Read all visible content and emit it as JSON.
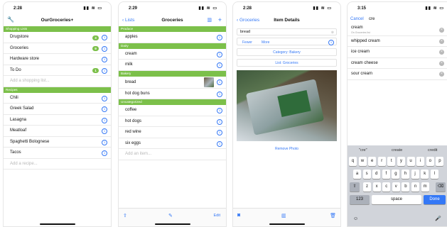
{
  "screen1": {
    "time": "2:28",
    "title": "OurGroceries+",
    "shopping_section": "Shopping Lists",
    "lists": [
      {
        "name": "Drugstore",
        "badge": "3"
      },
      {
        "name": "Groceries",
        "badge": "9"
      },
      {
        "name": "Hardware store",
        "badge": ""
      },
      {
        "name": "To Do",
        "badge": "1"
      }
    ],
    "add_list_placeholder": "Add a shopping list...",
    "recipes_section": "Recipes",
    "recipes": [
      "Chili",
      "Greek Salad",
      "Lasagna",
      "Meatloaf",
      "Spaghetti Bolognese",
      "Tacos"
    ],
    "add_recipe_placeholder": "Add a recipe..."
  },
  "screen2": {
    "time": "2:29",
    "back": "Lists",
    "title": "Groceries",
    "sections": [
      {
        "name": "Produce",
        "items": [
          "apples"
        ]
      },
      {
        "name": "Dairy",
        "items": [
          "cream",
          "milk"
        ]
      },
      {
        "name": "Bakery",
        "items": [
          "bread",
          "hot dog buns"
        ]
      },
      {
        "name": "Uncategorized",
        "items": [
          "coffee",
          "hot dogs",
          "red wine",
          "six eggs"
        ]
      }
    ],
    "add_item_placeholder": "Add an item...",
    "edit": "Edit"
  },
  "screen3": {
    "time": "2:28",
    "back": "Groceries",
    "title": "Item Details",
    "item_name": "bread",
    "fewer": "Fewer",
    "more": "More",
    "category_button": "Category: Bakery",
    "list_button": "List: Groceries",
    "remove_photo": "Remove Photo"
  },
  "screen4": {
    "time": "3:15",
    "cancel": "Cancel",
    "query": "cre",
    "results": [
      {
        "text": "cream",
        "sub": "On Groceries list"
      },
      {
        "text": "whipped cream",
        "sub": ""
      },
      {
        "text": "ice cream",
        "sub": ""
      },
      {
        "text": "cream cheese",
        "sub": ""
      },
      {
        "text": "sour cream",
        "sub": ""
      }
    ],
    "suggestions": [
      "\"cre\"",
      "create",
      "credit"
    ],
    "row1": [
      "q",
      "w",
      "e",
      "r",
      "t",
      "y",
      "u",
      "i",
      "o",
      "p"
    ],
    "row2": [
      "a",
      "s",
      "d",
      "f",
      "g",
      "h",
      "j",
      "k",
      "l"
    ],
    "row3": [
      "z",
      "x",
      "c",
      "v",
      "b",
      "n",
      "m"
    ],
    "numbers_key": "123",
    "space_key": "space",
    "done_key": "Done"
  },
  "colors": {
    "accent": "#3478f6",
    "section_green": "#7cc04a"
  }
}
